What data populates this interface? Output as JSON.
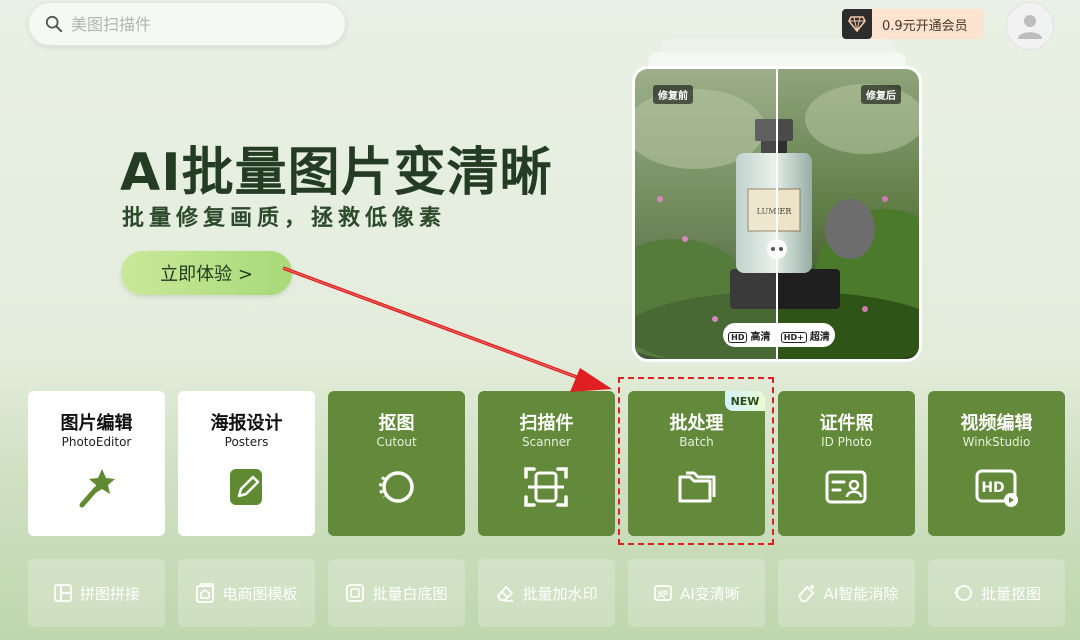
{
  "search": {
    "placeholder": "美图扫描件"
  },
  "vip": {
    "label": "0.9元开通会员"
  },
  "hero": {
    "title": "AI批量图片变清晰",
    "subtitle": "批量修复画质，拯救低像素",
    "cta": "立即体验 >"
  },
  "preview": {
    "before_tag": "修复前",
    "after_tag": "修复后",
    "hd_label": "高清",
    "uhd_label": "超清",
    "hd_box": "HD",
    "uhd_box": "HD+",
    "bottle_label": "LUMIER"
  },
  "features": [
    {
      "title": "图片编辑",
      "subtitle": "PhotoEditor",
      "icon": "magic-wand-icon",
      "style": "light"
    },
    {
      "title": "海报设计",
      "subtitle": "Posters",
      "icon": "poster-edit-icon",
      "style": "light"
    },
    {
      "title": "抠图",
      "subtitle": "Cutout",
      "icon": "cutout-icon",
      "style": "dark"
    },
    {
      "title": "扫描件",
      "subtitle": "Scanner",
      "icon": "scanner-icon",
      "style": "dark"
    },
    {
      "title": "批处理",
      "subtitle": "Batch",
      "icon": "folder-icon",
      "style": "dark",
      "badge": "NEW"
    },
    {
      "title": "证件照",
      "subtitle": "ID Photo",
      "icon": "id-card-icon",
      "style": "dark"
    },
    {
      "title": "视频编辑",
      "subtitle": "WinkStudio",
      "icon": "hd-video-icon",
      "style": "dark"
    }
  ],
  "tools": [
    {
      "label": "拼图拼接",
      "icon": "collage-icon"
    },
    {
      "label": "电商图模板",
      "icon": "shop-template-icon"
    },
    {
      "label": "批量白底图",
      "icon": "white-bg-icon"
    },
    {
      "label": "批量加水印",
      "icon": "watermark-icon"
    },
    {
      "label": "AI变清晰",
      "icon": "hd-image-icon"
    },
    {
      "label": "AI智能消除",
      "icon": "eraser-icon"
    },
    {
      "label": "批量抠图",
      "icon": "batch-cutout-icon"
    }
  ],
  "colors": {
    "feature_dark": "#628a3a",
    "highlight_red": "#e02020",
    "cta_green": "#b7e088",
    "title_green": "#243c24"
  }
}
